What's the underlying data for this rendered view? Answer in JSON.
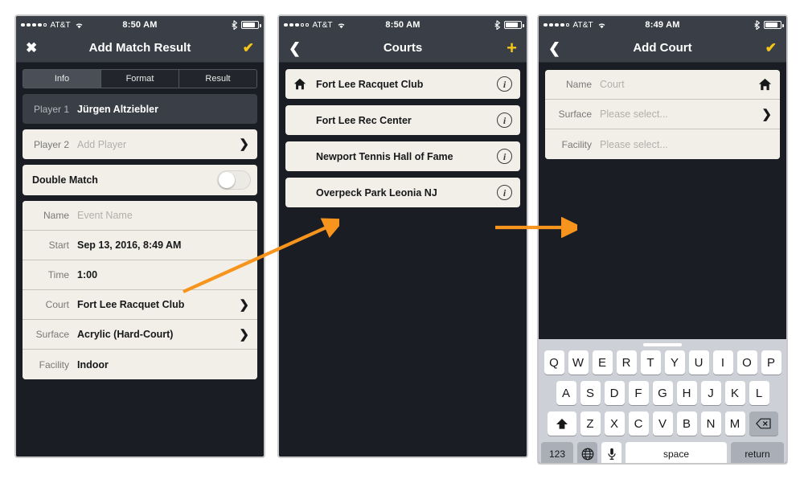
{
  "accent": {
    "yellow": "#f5c518",
    "orange": "#f7941e",
    "nav_bg": "#3a3f47",
    "screen_bg": "#1a1e24",
    "card_bg": "#f2efe9"
  },
  "phone1": {
    "status": {
      "carrier": "AT&T",
      "time": "8:50 AM",
      "signal_filled": 4,
      "signal_total": 5,
      "wifi": "wifi-icon",
      "bluetooth": "bluetooth-icon",
      "battery": "battery-icon"
    },
    "nav": {
      "left_icon": "close-icon",
      "left_glyph": "✖",
      "title": "Add Match Result",
      "right_icon": "checkmark-icon",
      "right_glyph": "✔"
    },
    "tabs": [
      {
        "label": "Info",
        "active": true
      },
      {
        "label": "Format",
        "active": false
      },
      {
        "label": "Result",
        "active": false
      }
    ],
    "player1": {
      "label": "Player 1",
      "value": "Jürgen Altziebler"
    },
    "player2": {
      "label": "Player 2",
      "value": "Add Player",
      "placeholder": true,
      "chevron": "❯"
    },
    "double_match": {
      "label": "Double Match",
      "toggle_on": false
    },
    "details": [
      {
        "label": "Name",
        "value": "Event Name",
        "placeholder": true,
        "chevron": ""
      },
      {
        "label": "Start",
        "value": "Sep 13, 2016, 8:49 AM",
        "placeholder": false,
        "chevron": ""
      },
      {
        "label": "Time",
        "value": "1:00",
        "placeholder": false,
        "chevron": ""
      },
      {
        "label": "Court",
        "value": "Fort Lee Racquet Club",
        "placeholder": false,
        "chevron": "❯"
      },
      {
        "label": "Surface",
        "value": "Acrylic (Hard-Court)",
        "placeholder": false,
        "chevron": "❯"
      },
      {
        "label": "Facility",
        "value": "Indoor",
        "placeholder": false,
        "chevron": ""
      }
    ]
  },
  "phone2": {
    "status": {
      "carrier": "AT&T",
      "time": "8:50 AM",
      "signal_filled": 3,
      "signal_total": 5,
      "wifi": "wifi-icon",
      "bluetooth": "bluetooth-icon",
      "battery": "battery-icon"
    },
    "nav": {
      "left_icon": "back-chevron-icon",
      "left_glyph": "❮",
      "title": "Courts",
      "right_icon": "plus-icon",
      "right_glyph": "+"
    },
    "courts": [
      {
        "name": "Fort Lee Racquet Club",
        "home": true,
        "info": "i"
      },
      {
        "name": "Fort Lee Rec Center",
        "home": false,
        "info": "i"
      },
      {
        "name": "Newport Tennis Hall of Fame",
        "home": false,
        "info": "i"
      },
      {
        "name": "Overpeck Park Leonia NJ",
        "home": false,
        "info": "i"
      }
    ]
  },
  "phone3": {
    "status": {
      "carrier": "AT&T",
      "time": "8:49 AM",
      "signal_filled": 4,
      "signal_total": 5,
      "wifi": "wifi-icon",
      "bluetooth": "bluetooth-icon",
      "battery": "battery-icon"
    },
    "nav": {
      "left_icon": "back-chevron-icon",
      "left_glyph": "❮",
      "title": "Add Court",
      "right_icon": "checkmark-icon",
      "right_glyph": "✔"
    },
    "fields": [
      {
        "label": "Name",
        "value": "Court",
        "placeholder": true,
        "trailing": "home-icon"
      },
      {
        "label": "Surface",
        "value": "Please select...",
        "placeholder": true,
        "trailing": "chevron"
      },
      {
        "label": "Facility",
        "value": "Please select...",
        "placeholder": true,
        "trailing": ""
      }
    ],
    "keyboard": {
      "row1": [
        "Q",
        "W",
        "E",
        "R",
        "T",
        "Y",
        "U",
        "I",
        "O",
        "P"
      ],
      "row2": [
        "A",
        "S",
        "D",
        "F",
        "G",
        "H",
        "J",
        "K",
        "L"
      ],
      "row3": [
        "Z",
        "X",
        "C",
        "V",
        "B",
        "N",
        "M"
      ],
      "shift": "⬆",
      "backspace": "⌫",
      "numbers": "123",
      "globe": "ἱ0",
      "mic": "mic-icon",
      "space": "space",
      "return": "return"
    }
  },
  "annotations": {
    "arrow1": "arrow-court-to-courts-list",
    "arrow2": "arrow-courts-list-to-add-court"
  }
}
